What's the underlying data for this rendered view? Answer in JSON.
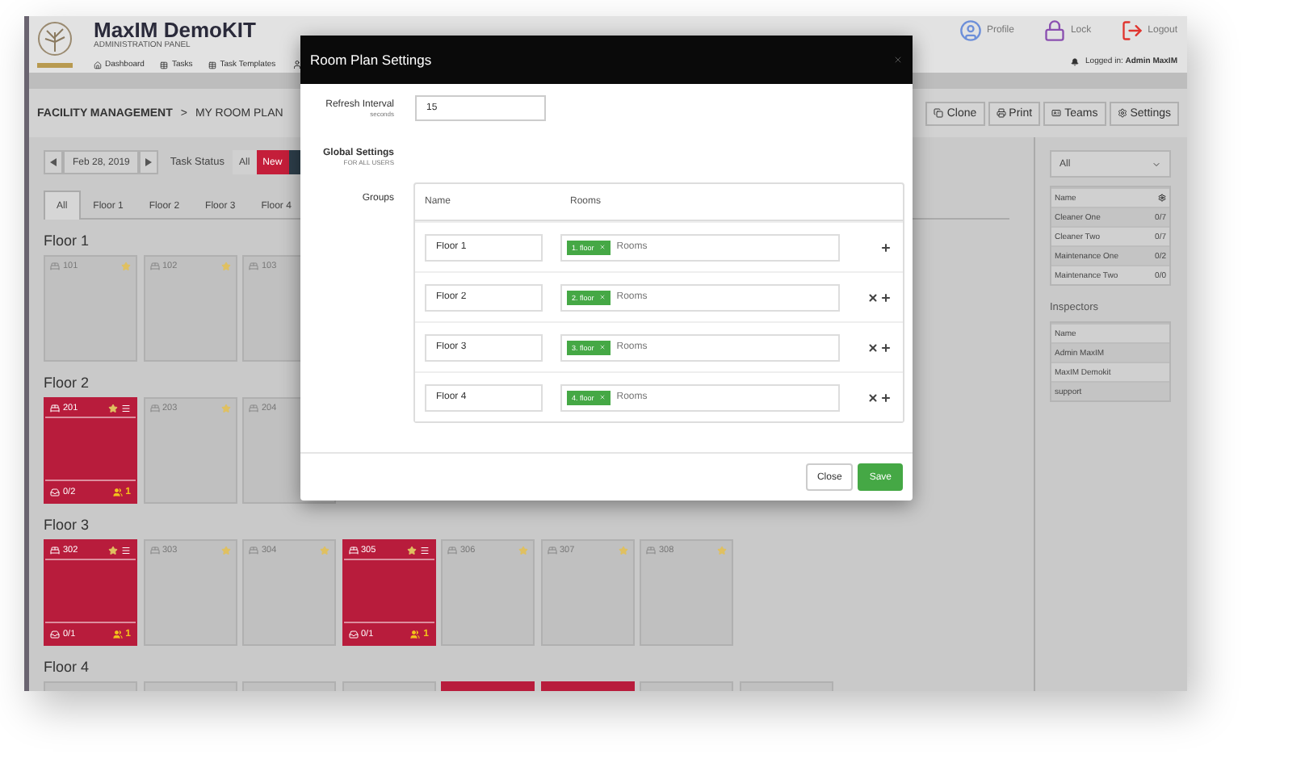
{
  "app": {
    "title": "MaxIM DemoKIT",
    "subtitle": "ADMINISTRATION PANEL",
    "nav": [
      "Dashboard",
      "Tasks",
      "Task Templates"
    ],
    "top_links": [
      "Profile",
      "Lock",
      "Logout"
    ],
    "logged_in": "Logged in: **Admin MaxIM**"
  },
  "breadcrumb": {
    "items": [
      "FACILITY MANAGEMENT",
      "MY ROOM PLAN"
    ],
    "separator": ">"
  },
  "toolbar_buttons": [
    "Clone",
    "Print",
    "Teams",
    "Settings"
  ],
  "date_nav": {
    "date": "Feb 28, 2019"
  },
  "task_status": {
    "label": "Task Status",
    "options": [
      {
        "label": "All",
        "color": "#d0d0d0"
      },
      {
        "label": "New",
        "color": "#c41e3a"
      },
      {
        "color": "#2d3e4a"
      }
    ]
  },
  "floor_tabs": [
    {
      "label": "All",
      "selected": true
    },
    {
      "label": "Floor 1",
      "selected": false
    },
    {
      "label": "Floor 2",
      "selected": false
    },
    {
      "label": "Floor 3",
      "selected": false
    },
    {
      "label": "Floor 4",
      "selected": false
    }
  ],
  "floors": [
    {
      "title": "Floor 1",
      "rooms": [
        {
          "number": "101",
          "occupied": false
        },
        {
          "number": "102",
          "occupied": false
        },
        {
          "number": "103",
          "occupied": false
        }
      ]
    },
    {
      "title": "Floor 2",
      "rooms": [
        {
          "number": "201",
          "occupied": true,
          "count": "0/2",
          "people": "1"
        },
        {
          "number": "203",
          "occupied": false
        },
        {
          "number": "204",
          "occupied": false
        }
      ]
    },
    {
      "title": "Floor 3",
      "rooms": [
        {
          "number": "302",
          "occupied": true,
          "count": "0/1",
          "people": "1"
        },
        {
          "number": "303",
          "occupied": false
        },
        {
          "number": "304",
          "occupied": false
        },
        {
          "number": "305",
          "occupied": true,
          "count": "0/1",
          "people": "1"
        },
        {
          "number": "306",
          "occupied": false
        },
        {
          "number": "307",
          "occupied": false
        },
        {
          "number": "308",
          "occupied": false
        }
      ]
    },
    {
      "title": "Floor 4",
      "rooms": [
        {
          "occupied": false
        },
        {
          "occupied": false
        },
        {
          "occupied": false
        },
        {
          "occupied": false
        },
        {
          "occupied": true
        },
        {
          "occupied": true
        },
        {
          "occupied": false
        },
        {
          "occupied": false
        }
      ]
    }
  ],
  "side_panel": {
    "filter": {
      "value": "All"
    },
    "teams": {
      "column": "Name",
      "rows": [
        {
          "name": "Cleaner One",
          "count": "0/7"
        },
        {
          "name": "Cleaner Two",
          "count": "0/7"
        },
        {
          "name": "Maintenance One",
          "count": "0/2"
        },
        {
          "name": "Maintenance Two",
          "count": "0/0"
        }
      ]
    },
    "inspectors": {
      "title": "Inspectors",
      "column": "Name",
      "rows": [
        "Admin MaxIM",
        "MaxIM Demokit",
        "support"
      ]
    }
  },
  "modal": {
    "title": "Room Plan Settings",
    "refresh": {
      "label": "Refresh Interval",
      "hint": "seconds",
      "value": "15"
    },
    "global": {
      "label": "Global Settings",
      "hint": "FOR ALL USERS"
    },
    "groups": {
      "label": "Groups",
      "columns": [
        "Name",
        "Rooms"
      ],
      "rows": [
        {
          "name": "Floor 1",
          "tags": [
            "1. floor"
          ],
          "placeholder": "Rooms",
          "removable": false
        },
        {
          "name": "Floor 2",
          "tags": [
            "2. floor"
          ],
          "placeholder": "Rooms",
          "removable": true
        },
        {
          "name": "Floor 3",
          "tags": [
            "3. floor"
          ],
          "placeholder": "Rooms",
          "removable": true
        },
        {
          "name": "Floor 4",
          "tags": [
            "4. floor"
          ],
          "placeholder": "Rooms",
          "removable": true
        }
      ]
    },
    "buttons": [
      "Close",
      "Save"
    ]
  }
}
